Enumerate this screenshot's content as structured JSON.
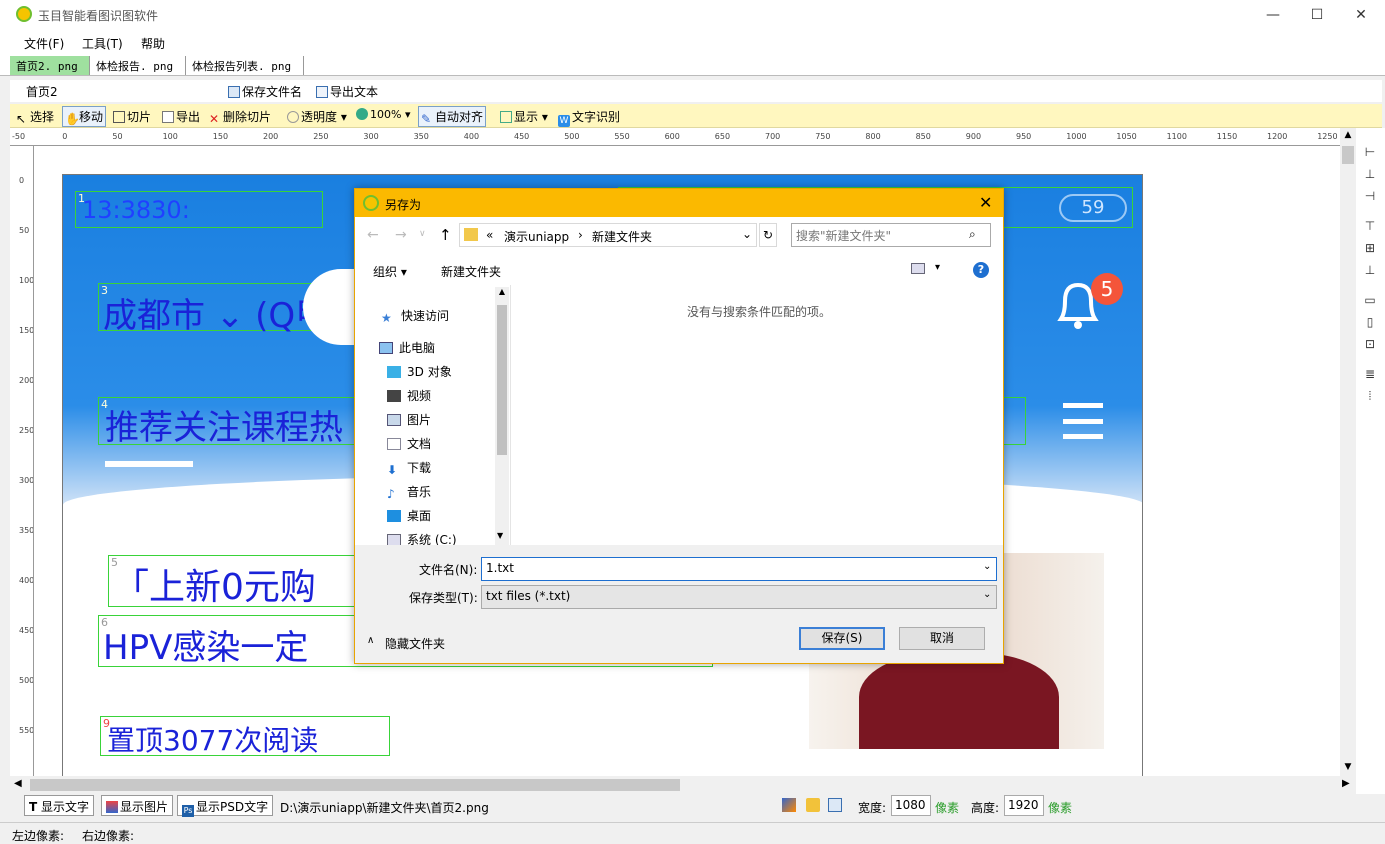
{
  "app": {
    "title": "玉目智能看图识图软件"
  },
  "window_controls": {
    "minimize": "—",
    "maximize": "☐",
    "close": "✕"
  },
  "menu": {
    "items": [
      "文件(F)",
      "工具(T)",
      "帮助"
    ]
  },
  "tabs": [
    "首页2. png",
    "体检报告. png",
    "体检报告列表. png"
  ],
  "toolbar1": {
    "name": "首页2",
    "save_filename": "保存文件名",
    "export_text": "导出文本"
  },
  "toolbar2": {
    "select": "选择",
    "move": "移动",
    "slice": "切片",
    "export": "导出",
    "delete_slice": "删除切片",
    "opacity": "透明度",
    "zoom": "100%",
    "auto_align": "自动对齐",
    "display": "显示",
    "ocr": "文字识别"
  },
  "ruler_h": [
    "-50",
    "0",
    "50",
    "100",
    "150",
    "200",
    "250",
    "300",
    "350",
    "400",
    "450",
    "500",
    "550",
    "600",
    "650",
    "700",
    "750",
    "800",
    "850",
    "900",
    "950",
    "1000",
    "1050",
    "1100",
    "1150",
    "1200",
    "1250"
  ],
  "ruler_v": [
    "-50",
    "0",
    "50",
    "100",
    "150",
    "200",
    "250",
    "300",
    "350",
    "400",
    "450",
    "500",
    "550"
  ],
  "image": {
    "time": "13:3830:",
    "city": "成都市 ⌄ (Q甲⺮",
    "nav_tabs": "推荐关注课程热",
    "nav_tail": "E",
    "badge": "5",
    "battery": "59",
    "headline1": "「上新0元购",
    "headline2": "HPV感染一定",
    "readcount": "置顶3077次阅读",
    "slice_nums": [
      "1",
      "3",
      "4",
      "5",
      "6",
      "9"
    ]
  },
  "dialog": {
    "title": "另存为",
    "path": [
      "«",
      "演示uniapp",
      "›",
      "新建文件夹"
    ],
    "search_placeholder": "搜索\"新建文件夹\"",
    "organize": "组织 ▾",
    "new_folder": "新建文件夹",
    "empty_message": "没有与搜索条件匹配的项。",
    "nav": [
      "快速访问",
      "此电脑",
      "3D 对象",
      "视频",
      "图片",
      "文档",
      "下载",
      "音乐",
      "桌面",
      "系统 (C:)"
    ],
    "filename_label": "文件名(N):",
    "filename_value": "1.txt",
    "filetype_label": "保存类型(T):",
    "filetype_value": "txt files (*.txt)",
    "hide_folders": "隐藏文件夹",
    "save": "保存(S)",
    "cancel": "取消"
  },
  "statusbar": {
    "show_text": "显示文字",
    "show_image": "显示图片",
    "show_psd": "显示PSD文字",
    "path": "D:\\演示uniapp\\新建文件夹\\首页2.png",
    "width_label": "宽度:",
    "width_value": "1080",
    "height_label": "高度:",
    "height_value": "1920",
    "unit": "像素"
  },
  "bottom": {
    "left_px": "左边像素:",
    "right_px": "右边像素:"
  },
  "colors": {
    "dialog_title": "#fbb900",
    "active_tab": "#9fe09f",
    "toolbar2": "#fff7bf",
    "header_blue": "#1a7fe0",
    "overlay_text": "#1a22d8",
    "slice_border": "#39d339",
    "badge": "#f4553a"
  }
}
